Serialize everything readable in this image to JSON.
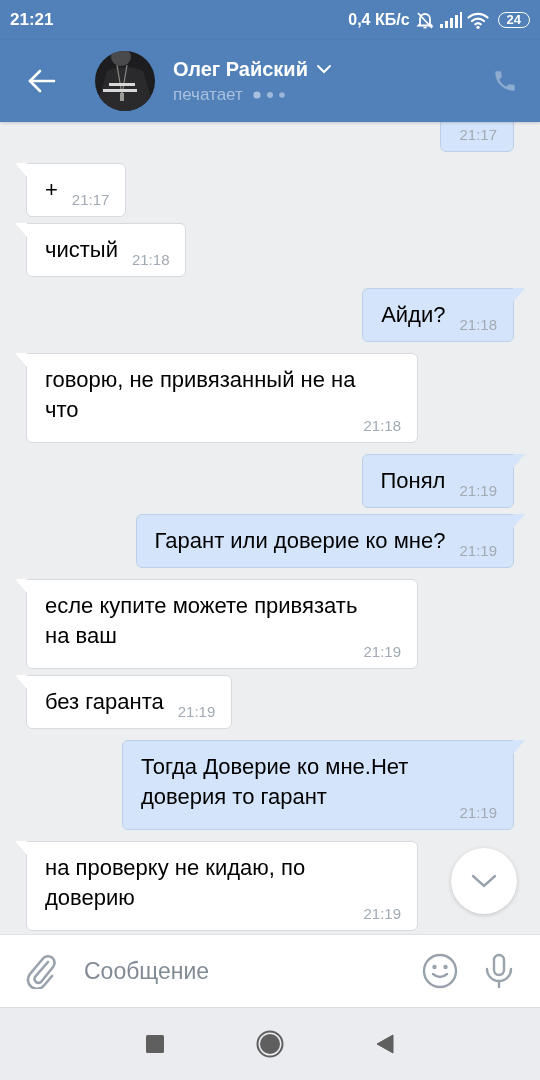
{
  "status_bar": {
    "time": "21:21",
    "speed": "0,4 КБ/с",
    "battery": "24"
  },
  "header": {
    "name": "Олег Райский",
    "status": "печатает"
  },
  "messages": [
    {
      "outgoing": true,
      "time": "21:17"
    },
    {
      "outgoing": false,
      "text": "+",
      "time": "21:17"
    },
    {
      "outgoing": false,
      "text": "чистый",
      "time": "21:18"
    },
    {
      "outgoing": true,
      "text": "Айди?",
      "time": "21:18"
    },
    {
      "outgoing": false,
      "text": "говорю, не привязанный не на что",
      "time": "21:18"
    },
    {
      "outgoing": true,
      "text": "Понял",
      "time": "21:19"
    },
    {
      "outgoing": true,
      "text": "Гарант или доверие ко мне?",
      "time": "21:19"
    },
    {
      "outgoing": false,
      "text": "есле купите можете привязать на ваш",
      "time": "21:19"
    },
    {
      "outgoing": false,
      "text": "без гаранта",
      "time": "21:19"
    },
    {
      "outgoing": true,
      "text": "Тогда Доверие ко мне.Нет доверия то гарант",
      "time": "21:19"
    },
    {
      "outgoing": false,
      "text": "на проверку не кидаю, по доверию",
      "time": "21:19"
    }
  ],
  "composer": {
    "placeholder": "Сообщение"
  }
}
